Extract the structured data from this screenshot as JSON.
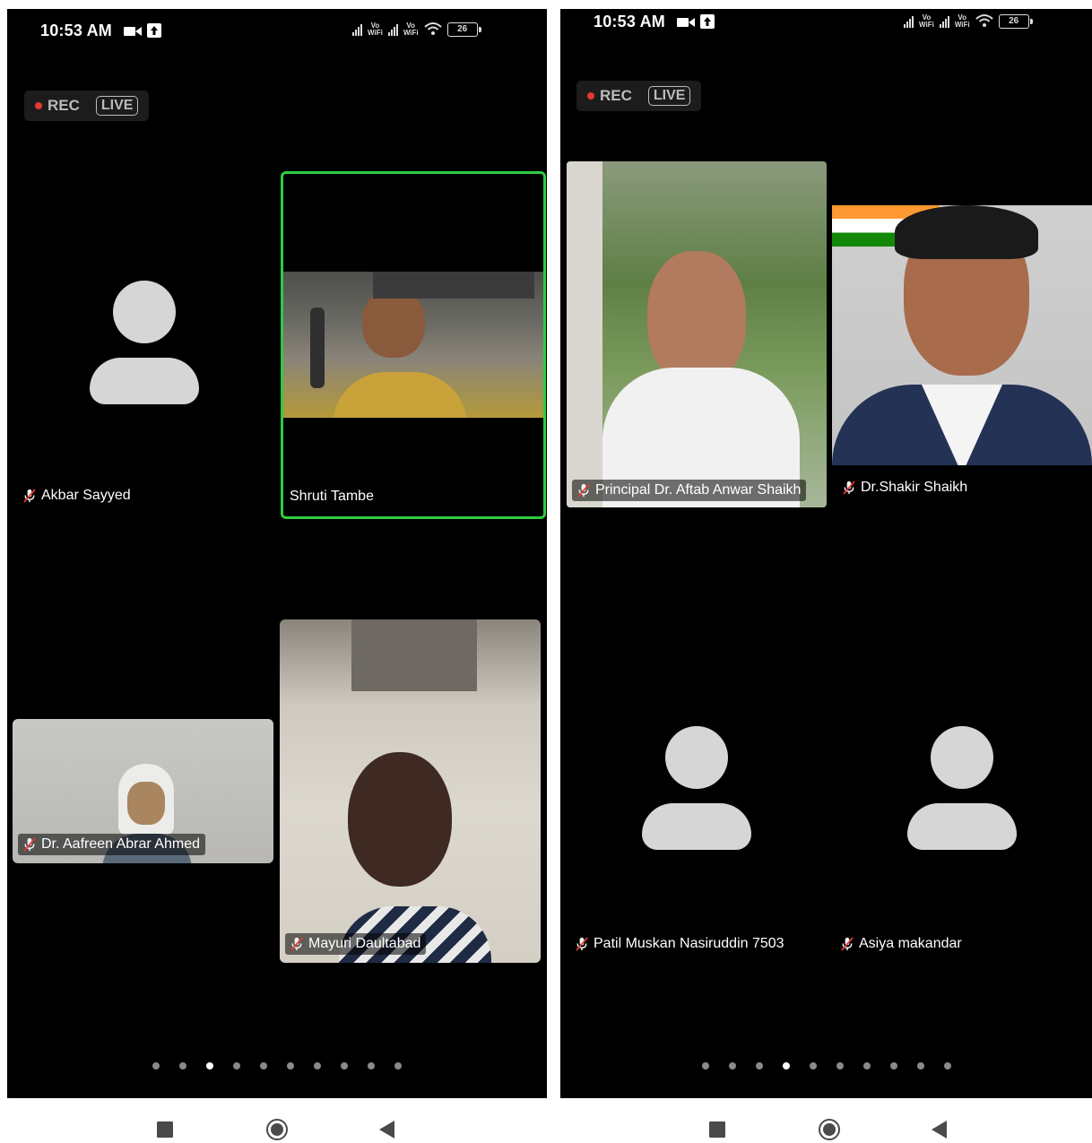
{
  "colors": {
    "background": "#000000",
    "active_speaker_border": "#2ecc40",
    "rec_dot": "#e53935",
    "avatar": "#d6d6d6",
    "dot_active": "#ffffff",
    "dot_inactive": "#8a8a8a"
  },
  "screens": [
    {
      "status": {
        "time": "10:53 AM",
        "vowifi_1": "Vo\nWiFi",
        "vowifi_2": "Vo\nWiFi",
        "battery": "26"
      },
      "recording": {
        "rec_label": "REC",
        "live_label": "LIVE"
      },
      "participants": [
        {
          "name": "Akbar Sayyed",
          "muted": true,
          "video": false,
          "icon": "person-avatar-icon"
        },
        {
          "name": "Shruti Tambe",
          "muted": false,
          "video": true,
          "active_speaker": true
        },
        {
          "name": "Dr. Aafreen Abrar Ahmed",
          "muted": true,
          "video": true
        },
        {
          "name": "Mayuri Daultabad",
          "muted": true,
          "video": true
        }
      ],
      "pagination": {
        "pages": 10,
        "current": 3
      }
    },
    {
      "status": {
        "time": "10:53 AM",
        "vowifi_1": "Vo\nWiFi",
        "vowifi_2": "Vo\nWiFi",
        "battery": "26"
      },
      "recording": {
        "rec_label": "REC",
        "live_label": "LIVE"
      },
      "participants": [
        {
          "name": "Principal Dr. Aftab Anwar Shaikh",
          "muted": true,
          "video": true
        },
        {
          "name": "Dr.Shakir Shaikh",
          "muted": true,
          "video": true
        },
        {
          "name": "Patil Muskan Nasiruddin 7503",
          "muted": true,
          "video": false,
          "icon": "person-avatar-icon"
        },
        {
          "name": "Asiya makandar",
          "muted": true,
          "video": false,
          "icon": "person-avatar-icon"
        }
      ],
      "pagination": {
        "pages": 10,
        "current": 4
      }
    }
  ],
  "navbar_icons": [
    "recents-square-icon",
    "home-circle-icon",
    "back-triangle-icon"
  ]
}
